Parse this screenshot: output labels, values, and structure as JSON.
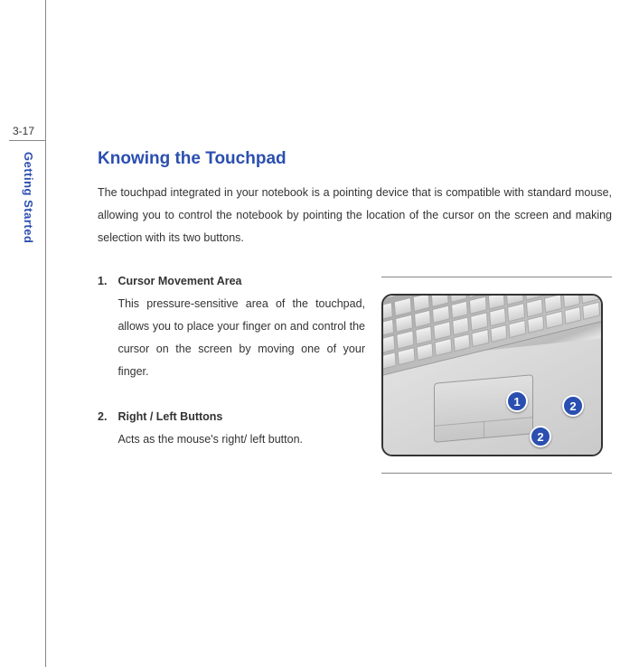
{
  "page_number": "3-17",
  "side_label": "Getting Started",
  "section_title": "Knowing the Touchpad",
  "intro_text": "The touchpad integrated in your notebook is a pointing device that is compatible with standard mouse, allowing you to control the notebook by pointing the location of the cursor on the screen and making selection with its two buttons.",
  "items": [
    {
      "number": "1.",
      "title": "Cursor Movement Area",
      "desc": "This pressure-sensitive area of the touchpad, allows you to place your finger on and control the cursor on the screen by moving one of your finger."
    },
    {
      "number": "2.",
      "title": "Right / Left Buttons",
      "desc": "Acts as the mouse's right/ left button."
    }
  ],
  "callouts": [
    "1",
    "2",
    "2"
  ],
  "colors": {
    "accent": "#2b4fb0"
  }
}
